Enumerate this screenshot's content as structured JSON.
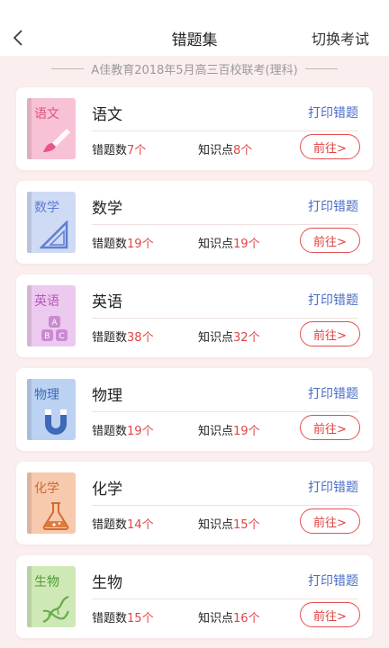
{
  "header": {
    "title": "错题集",
    "switch_label": "切换考试"
  },
  "exam_name": "A佳教育2018年5月高三百校联考(理科)",
  "labels": {
    "errors": "错题数",
    "points": "知识点",
    "unit": "个",
    "print": "打印错题",
    "go": "前往>"
  },
  "subjects": [
    {
      "name": "语文",
      "cover_label": "语文",
      "errors": "7",
      "points": "8",
      "cover_color": "#f8c2d6",
      "label_color": "#d9557f"
    },
    {
      "name": "数学",
      "cover_label": "数学",
      "errors": "19",
      "points": "19",
      "cover_color": "#cfdaf5",
      "label_color": "#5e7fd0"
    },
    {
      "name": "英语",
      "cover_label": "英语",
      "errors": "38",
      "points": "32",
      "cover_color": "#ecc9ee",
      "label_color": "#b35ab9"
    },
    {
      "name": "物理",
      "cover_label": "物理",
      "errors": "19",
      "points": "19",
      "cover_color": "#bcd2f2",
      "label_color": "#3e68b8"
    },
    {
      "name": "化学",
      "cover_label": "化学",
      "errors": "14",
      "points": "15",
      "cover_color": "#f7c9ad",
      "label_color": "#d46a2e"
    },
    {
      "name": "生物",
      "cover_label": "生物",
      "errors": "15",
      "points": "16",
      "cover_color": "#cfe9b6",
      "label_color": "#4f9a37"
    }
  ]
}
